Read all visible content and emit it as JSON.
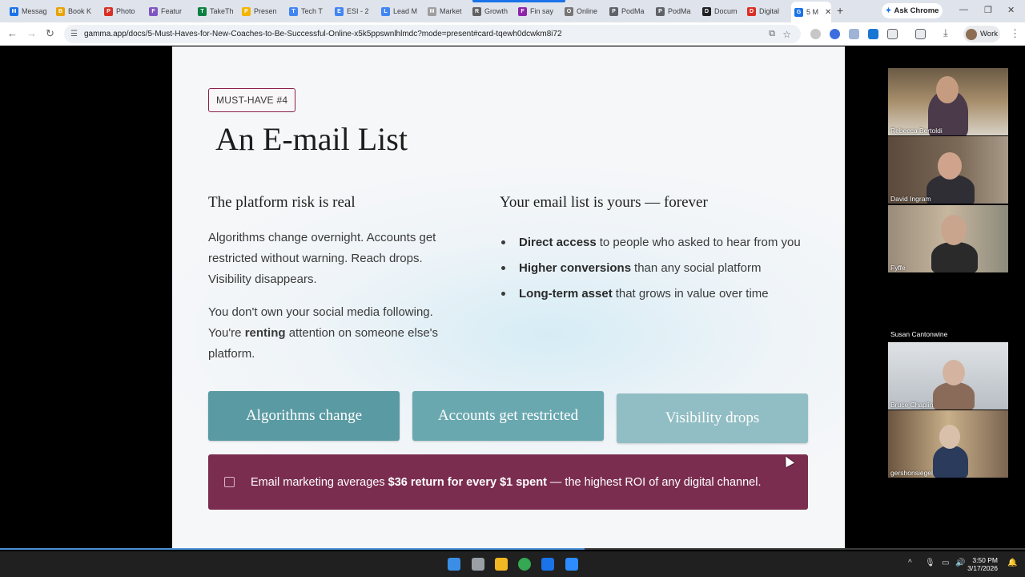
{
  "browser": {
    "tabs": [
      {
        "label": "Messag",
        "color": "#1a73e8",
        "glyph": "M"
      },
      {
        "label": "Book K",
        "color": "#e8a400",
        "glyph": "B"
      },
      {
        "label": "Photo",
        "color": "#d93025",
        "glyph": "P"
      },
      {
        "label": "Featur",
        "color": "#7e57c2",
        "glyph": "F"
      },
      {
        "label": "TakeTh",
        "color": "#0b8043",
        "glyph": "T"
      },
      {
        "label": "Presen",
        "color": "#f4b400",
        "glyph": "P"
      },
      {
        "label": "Tech T",
        "color": "#4285f4",
        "glyph": "T"
      },
      {
        "label": "ESI - 2",
        "color": "#4285f4",
        "glyph": "E"
      },
      {
        "label": "Lead M",
        "color": "#4285f4",
        "glyph": "L"
      },
      {
        "label": "Market",
        "color": "#9e9e9e",
        "glyph": "M"
      },
      {
        "label": "Growth",
        "color": "#616161",
        "glyph": "R"
      },
      {
        "label": "Fin say",
        "color": "#8e24aa",
        "glyph": "F"
      },
      {
        "label": "Online",
        "color": "#757575",
        "glyph": "O"
      },
      {
        "label": "PodMa",
        "color": "#5f6368",
        "glyph": "P"
      },
      {
        "label": "PodMa",
        "color": "#5f6368",
        "glyph": "P"
      },
      {
        "label": "Docum",
        "color": "#202124",
        "glyph": "D"
      },
      {
        "label": "Digital",
        "color": "#d93025",
        "glyph": "D"
      },
      {
        "label": "5 M",
        "color": "#1a73e8",
        "glyph": "G"
      }
    ],
    "ask_chrome": "Ask Chrome",
    "url": "gamma.app/docs/5-Must-Haves-for-New-Coaches-to-Be-Successful-Online-x5k5ppswnlhlmdc?mode=present#card-tqewh0dcwkm8i72",
    "profile_label": "Work"
  },
  "slide": {
    "badge": "MUST-HAVE #4",
    "title": "An E-mail List",
    "left_heading": "The platform risk is real",
    "left_para1": "Algorithms change overnight. Accounts get restricted without warning. Reach drops. Visibility disappears.",
    "left_para2_a": "You don't own your social media following. You're ",
    "left_para2_bold": "renting",
    "left_para2_b": " attention on someone else's platform.",
    "right_heading": "Your email list is yours — forever",
    "bullets": [
      {
        "bold": "Direct access",
        "text": "to people who asked to hear from you"
      },
      {
        "bold": "Higher conversions",
        "text": "than any social platform"
      },
      {
        "bold": "Long-term asset",
        "text": "that grows in value over time"
      }
    ],
    "cards": [
      "Algorithms change",
      "Accounts get restricted",
      "Visibility drops"
    ],
    "roi_a": "Email marketing averages",
    "roi_bold": "$36 return for every $1 spent",
    "roi_b": "— the highest ROI of any digital channel."
  },
  "participants": [
    {
      "name": "Rebecca Bertoldi"
    },
    {
      "name": "David Ingram"
    },
    {
      "name": "Fyffe"
    },
    {
      "name": "Susan Cantonwine"
    },
    {
      "name": "Bruce Chaplin"
    },
    {
      "name": "gershonsiegel"
    }
  ],
  "taskbar": {
    "time": "3:50 PM",
    "date": "3/17/2026"
  }
}
